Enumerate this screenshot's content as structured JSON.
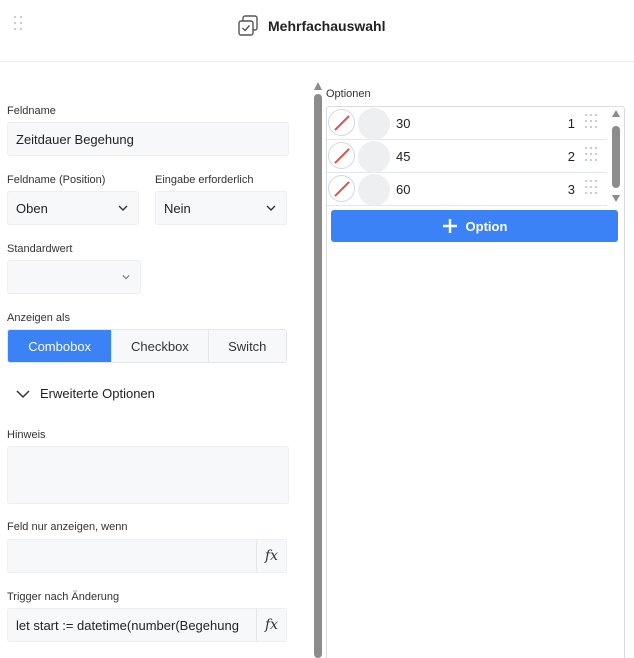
{
  "header": {
    "title": "Mehrfachauswahl"
  },
  "form": {
    "feldname_label": "Feldname",
    "feldname_value": "Zeitdauer Begehung",
    "position_label": "Feldname (Position)",
    "position_value": "Oben",
    "required_label": "Eingabe erforderlich",
    "required_value": "Nein",
    "default_label": "Standardwert",
    "default_value": "",
    "display_label": "Anzeigen als",
    "display_options": [
      "Combobox",
      "Checkbox",
      "Switch"
    ],
    "display_selected": "Combobox",
    "advanced_label": "Erweiterte Optionen",
    "hint_label": "Hinweis",
    "hint_value": "",
    "condition_label": "Feld nur anzeigen, wenn",
    "condition_value": "",
    "trigger_label": "Trigger nach Änderung",
    "trigger_value": "let start := datetime(number(Begehung",
    "fx_symbol": "fx"
  },
  "options": {
    "label": "Optionen",
    "items": [
      {
        "value": "30",
        "index": "1"
      },
      {
        "value": "45",
        "index": "2"
      },
      {
        "value": "60",
        "index": "3"
      }
    ],
    "add_label": "Option"
  },
  "colors": {
    "accent": "#3b82f6",
    "delete": "#d9534f"
  },
  "icons": {
    "header": "multi-select-icon",
    "drag": "drag-handle-icon",
    "delete": "delete-icon",
    "add": "plus-icon",
    "expand": "chevron-down-icon",
    "formula": "formula-icon"
  }
}
